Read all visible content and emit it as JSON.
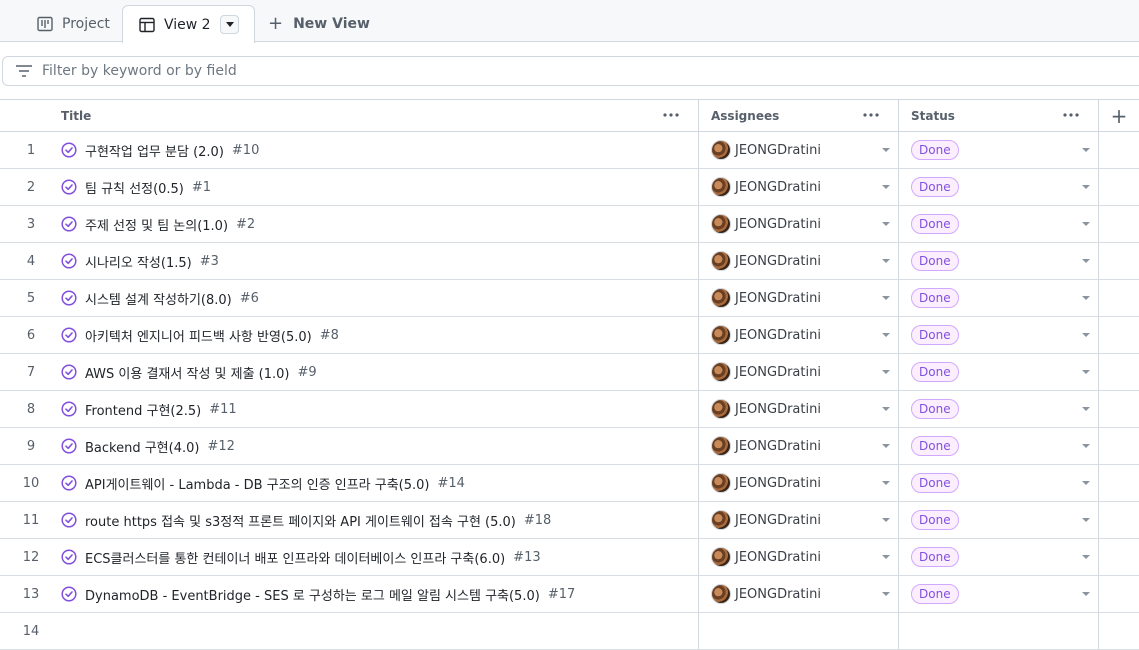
{
  "tabs": {
    "project_label": "Project",
    "view_label": "View 2",
    "new_view_label": "New View"
  },
  "filter": {
    "placeholder": "Filter by keyword or by field"
  },
  "columns": {
    "title": "Title",
    "assignees": "Assignees",
    "status": "Status"
  },
  "colors": {
    "status_done": "#8250df",
    "check": "#8250df"
  },
  "rows": [
    {
      "n": "1",
      "title": "구현작업 업무 분담 (2.0)",
      "issue": "#10",
      "assignee": "JEONGDratini",
      "status": "Done"
    },
    {
      "n": "2",
      "title": "팀 규칙 선정(0.5)",
      "issue": "#1",
      "assignee": "JEONGDratini",
      "status": "Done"
    },
    {
      "n": "3",
      "title": "주제 선정 및 팀 논의(1.0)",
      "issue": "#2",
      "assignee": "JEONGDratini",
      "status": "Done"
    },
    {
      "n": "4",
      "title": "시나리오 작성(1.5)",
      "issue": "#3",
      "assignee": "JEONGDratini",
      "status": "Done"
    },
    {
      "n": "5",
      "title": "시스템 설계 작성하기(8.0)",
      "issue": "#6",
      "assignee": "JEONGDratini",
      "status": "Done"
    },
    {
      "n": "6",
      "title": "아키텍처 엔지니어 피드백 사항 반영(5.0)",
      "issue": "#8",
      "assignee": "JEONGDratini",
      "status": "Done"
    },
    {
      "n": "7",
      "title": "AWS 이용 결재서 작성 및 제출 (1.0)",
      "issue": "#9",
      "assignee": "JEONGDratini",
      "status": "Done"
    },
    {
      "n": "8",
      "title": "Frontend 구현(2.5)",
      "issue": "#11",
      "assignee": "JEONGDratini",
      "status": "Done"
    },
    {
      "n": "9",
      "title": "Backend 구현(4.0)",
      "issue": "#12",
      "assignee": "JEONGDratini",
      "status": "Done"
    },
    {
      "n": "10",
      "title": "API게이트웨이 - Lambda - DB 구조의 인증 인프라 구축(5.0)",
      "issue": "#14",
      "assignee": "JEONGDratini",
      "status": "Done"
    },
    {
      "n": "11",
      "title": "route https 접속 및 s3정적 프론트 페이지와 API 게이트웨이 접속 구현 (5.0)",
      "issue": "#18",
      "assignee": "JEONGDratini",
      "status": "Done"
    },
    {
      "n": "12",
      "title": "ECS클러스터를 통한 컨테이너 배포 인프라와 데이터베이스 인프라 구축(6.0)",
      "issue": "#13",
      "assignee": "JEONGDratini",
      "status": "Done"
    },
    {
      "n": "13",
      "title": "DynamoDB - EventBridge - SES 로 구성하는 로그 메일 알림 시스템 구축(5.0)",
      "issue": "#17",
      "assignee": "JEONGDratini",
      "status": "Done"
    },
    {
      "n": "14",
      "title": "",
      "issue": "",
      "assignee": "",
      "status": ""
    }
  ]
}
